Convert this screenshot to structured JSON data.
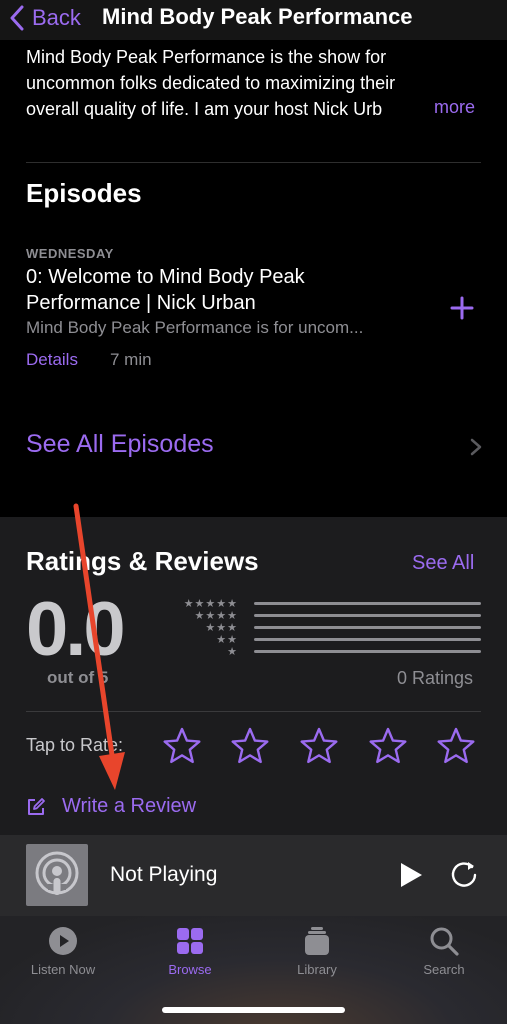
{
  "nav": {
    "back_label": "Back",
    "title": "Mind Body Peak Performance"
  },
  "description": {
    "lines": [
      "Mind Body Peak Performance is the show for",
      "uncommon folks dedicated to maximizing their",
      "overall quality of life. I am your host Nick Urb"
    ],
    "more_label": "more"
  },
  "episodes": {
    "heading": "Episodes",
    "item": {
      "day": "WEDNESDAY",
      "title_lines": [
        "0: Welcome to Mind Body Peak",
        "Performance | Nick Urban"
      ],
      "summary": "Mind Body Peak Performance is for uncom...",
      "details_label": "Details",
      "duration": "7 min"
    },
    "see_all_label": "See All Episodes"
  },
  "ratings": {
    "heading": "Ratings & Reviews",
    "see_all_label": "See All",
    "score": "0.0",
    "out_of": "out of 5",
    "star_rows": [
      "★★★★★",
      "★★★★",
      "★★★",
      "★★",
      "★"
    ],
    "bar_fill_fractions": [
      0,
      0,
      0,
      0,
      0
    ],
    "count_label": "0 Ratings",
    "tap_to_rate_label": "Tap to Rate:",
    "write_review_label": "Write a Review"
  },
  "player": {
    "status": "Not Playing"
  },
  "tabs": [
    {
      "label": "Listen Now",
      "icon": "play-circle-icon"
    },
    {
      "label": "Browse",
      "icon": "grid-icon",
      "active": true
    },
    {
      "label": "Library",
      "icon": "stack-icon"
    },
    {
      "label": "Search",
      "icon": "search-icon"
    }
  ],
  "colors": {
    "accent": "#9b6bf0",
    "annotation_arrow": "#e8452c",
    "secondary_text": "#8e8e93"
  }
}
